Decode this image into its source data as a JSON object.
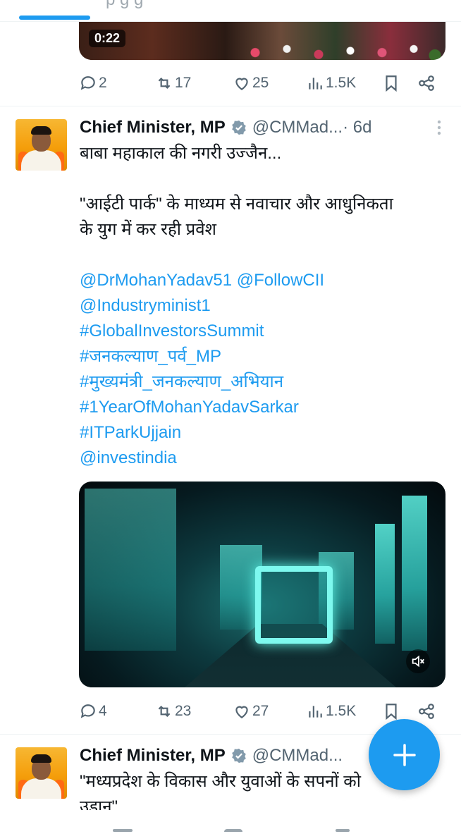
{
  "top_tab": {
    "ghost_text": "p                g g"
  },
  "tweet1": {
    "video_time": "0:22",
    "actions": {
      "replies": "2",
      "reposts": "17",
      "likes": "25",
      "views": "1.5K"
    }
  },
  "tweet2": {
    "name": "Chief Minister, MP",
    "handle": "@CMMad...",
    "time": "· 6d",
    "lines": [
      "बाबा महाकाल की नगरी उज्जैन...",
      "\"आईटी पार्क\" के माध्यम से नवाचार और आधुनिकता",
      "के युग में कर रही प्रवेश"
    ],
    "links": [
      "@DrMohanYadav51 @FollowCII",
      "@Industryminist1",
      "#GlobalInvestorsSummit",
      "#जनकल्याण_पर्व_MP",
      "#मुख्यमंत्री_जनकल्याण_अभियान",
      "#1YearOfMohanYadavSarkar",
      "#ITParkUjjain",
      "@investindia"
    ],
    "actions": {
      "replies": "4",
      "reposts": "23",
      "likes": "27",
      "views": "1.5K"
    }
  },
  "tweet3": {
    "name": "Chief Minister, MP",
    "handle": "@CMMad...",
    "lines": [
      "\"मध्यप्रदेश के विकास और युवाओं के सपनों को",
      "उड़ान\""
    ]
  },
  "icons": {
    "reply": "reply-icon",
    "repost": "repost-icon",
    "like": "heart-icon",
    "views": "views-icon",
    "bookmark": "bookmark-icon",
    "share": "share-icon",
    "verified": "verified-badge-icon",
    "more": "more-icon",
    "mute": "mute-icon",
    "compose": "plus-icon"
  },
  "colors": {
    "accent": "#1d9bf0",
    "text": "#0f1419",
    "muted": "#536471"
  }
}
